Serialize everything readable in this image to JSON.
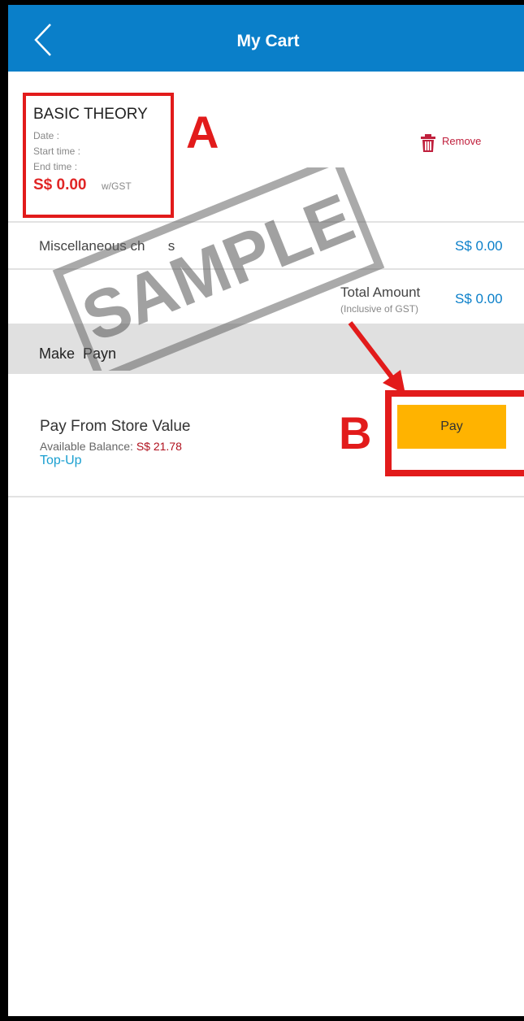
{
  "header": {
    "title": "My Cart"
  },
  "cart_item": {
    "name": "BASIC THEORY",
    "date_label": "Date :",
    "start_label": "Start time :",
    "end_label": "End time :",
    "price": "S$ 0.00",
    "gst_note": "w/GST",
    "remove_label": "Remove"
  },
  "misc": {
    "label": "Miscellaneous ch      s",
    "value": "S$ 0.00"
  },
  "total": {
    "label": "Total Amount",
    "sub": "(Inclusive of GST)",
    "value": "S$ 0.00"
  },
  "payment_bar": {
    "label": "Make  Payn"
  },
  "store_value": {
    "title": "Pay From Store Value",
    "balance_label": "Available Balance: ",
    "balance_value": "S$ 21.78",
    "topup_label": "Top-Up"
  },
  "pay_button": {
    "label": "Pay"
  },
  "annotations": {
    "a": "A",
    "b": "B",
    "stamp": "SAMPLE"
  },
  "colors": {
    "header": "#0a7fc9",
    "pay_button": "#ffb300",
    "annotation": "#e21b1b",
    "price": "#e02525"
  }
}
